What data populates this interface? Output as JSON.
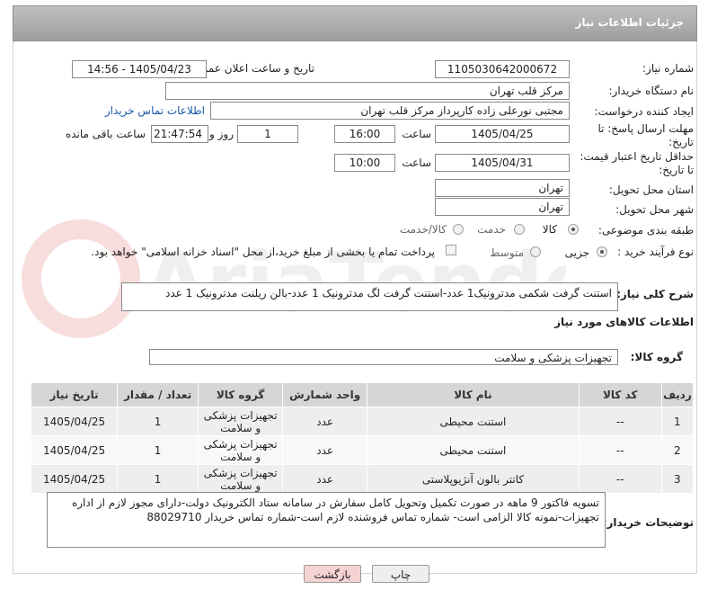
{
  "header": {
    "title": "جزئیات اطلاعات نیاز"
  },
  "form": {
    "need_number_label": "شماره نیاز:",
    "need_number": "1105030642000672",
    "announce_label": "تاریخ و ساعت اعلان عمومی:",
    "announce_value": "1405/04/23 - 14:56",
    "buyer_org_label": "نام دستگاه خریدار:",
    "buyer_org": "مرکز قلب تهران",
    "creator_label": "ایجاد کننده درخواست:",
    "creator": "مجتبی نورعلی زاده کارپرداز مرکز قلب تهران",
    "contact_link": "اطلاعات تماس خریدار",
    "deadline_label_1": "مهلت ارسال پاسخ: تا",
    "deadline_label_2": "تاریخ:",
    "deadline_date": "1405/04/25",
    "time_label": "ساعت",
    "deadline_time": "16:00",
    "days_value": "1",
    "days_label": "روز و",
    "remaining_time": "21:47:54",
    "remaining_label": "ساعت باقی مانده",
    "validity_label_1": "حداقل تاریخ اعتبار قیمت:",
    "validity_label_2": "تا تاریخ:",
    "validity_date": "1405/04/31",
    "validity_time_label": "ساعت",
    "validity_time": "10:00",
    "province_label": "استان محل تحویل:",
    "province": "تهران",
    "city_label": "شهر محل تحویل:",
    "city": "تهران",
    "category_label": "طبقه بندی موضوعی:",
    "category_options": [
      "کالا",
      "خدمت",
      "کالا/خدمت"
    ],
    "process_label": "نوع فرآیند خرید :",
    "process_options": [
      "جزیی",
      "متوسط"
    ],
    "payment_note": "پرداخت تمام یا بخشی از مبلغ خرید،از محل \"اسناد خزانه اسلامی\" خواهد بود."
  },
  "description": {
    "label": "شرح کلی نیاز:",
    "text": "استنت گرفت شکمی مدترونیک1 عدد-استنت گرفت لگ مدترونیک 1 عدد-بالن ریلنت مدترونیک 1 عدد"
  },
  "goods": {
    "section_title": "اطلاعات کالاهای مورد نیاز",
    "group_label": "گروه کالا:",
    "group_value": "تجهیزات پزشکی و سلامت",
    "columns": [
      "ردیف",
      "کد کالا",
      "نام کالا",
      "واحد شمارش",
      "گروه کالا",
      "تعداد / مقدار",
      "تاریخ نیاز"
    ],
    "rows": [
      [
        "1",
        "--",
        "استنت محیطی",
        "عدد",
        "تجهیزات پزشکی و سلامت",
        "1",
        "1405/04/25"
      ],
      [
        "2",
        "--",
        "استنت محیطی",
        "عدد",
        "تجهیزات پزشکی و سلامت",
        "1",
        "1405/04/25"
      ],
      [
        "3",
        "--",
        "کاتتر بالون آنژیوپلاستی",
        "عدد",
        "تجهیزات پزشکی و سلامت",
        "1",
        "1405/04/25"
      ]
    ]
  },
  "buyer_notes": {
    "label": "توضیحات خریدار:",
    "text": "تسویه فاکتور 9 ماهه در صورت تکمیل وتحویل کامل سفارش در سامانه  ستاد الکترونیک دولت-دارای مجوز لازم از اداره تجهیزات-نمونه کالا الزامی است- شماره تماس فروشنده لازم است-شماره تماس خریدار 88029710"
  },
  "buttons": {
    "print": "چاپ",
    "back": "بازگشت"
  },
  "colors": {
    "header": "#a9a9a9",
    "link": "#1a57a8",
    "back_button": "#f6d3d3",
    "print_button": "#eeeeee"
  }
}
